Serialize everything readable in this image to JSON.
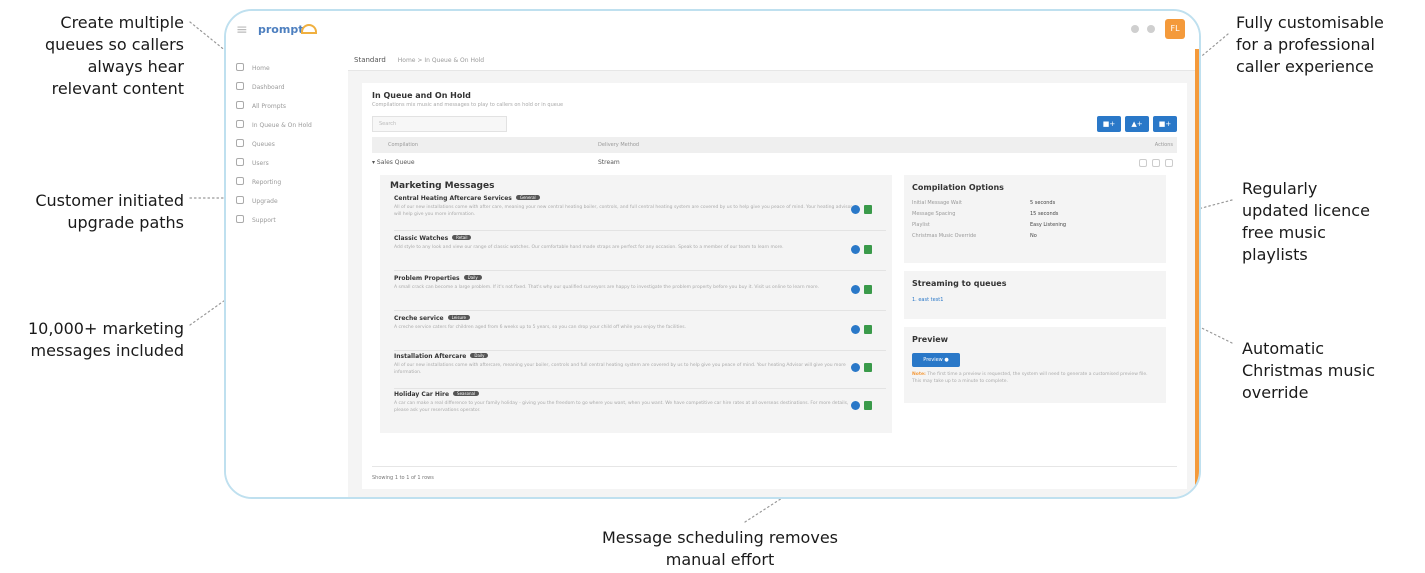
{
  "callouts": {
    "queues": [
      "Create multiple",
      "queues so callers",
      "always hear",
      "relevant content"
    ],
    "upgrade": [
      "Customer initiated",
      "upgrade paths"
    ],
    "marketing": [
      "10,000+ marketing",
      "messages included"
    ],
    "customisable": [
      "Fully customisable",
      "for a professional",
      "caller experience"
    ],
    "playlists": [
      "Regularly",
      "updated licence",
      "free music",
      "playlists"
    ],
    "christmas": [
      "Automatic",
      "Christmas music",
      "override"
    ],
    "scheduling": [
      "Message scheduling removes",
      "manual effort"
    ]
  },
  "app": {
    "logo": "prompt",
    "avatar": "FL"
  },
  "sidebar": {
    "items": [
      "Home",
      "Dashboard",
      "All Prompts",
      "In Queue & On Hold",
      "Queues",
      "Users",
      "Reporting",
      "Upgrade",
      "Support"
    ]
  },
  "breadcrumb": {
    "section": "Standard",
    "path": "Home > In Queue & On Hold"
  },
  "page": {
    "title": "In Queue and On Hold",
    "subtitle": "Compilations mix music and messages to play to callers on hold or in queue",
    "search_placeholder": "Search",
    "add_buttons": [
      "■+",
      "▲+",
      "■+"
    ]
  },
  "table": {
    "columns": [
      "Compilation",
      "Delivery Method",
      "Actions"
    ],
    "row": {
      "compilation": "▾ Sales Queue",
      "delivery": "Stream"
    }
  },
  "marketing": {
    "title": "Marketing Messages",
    "messages": [
      {
        "title": "Central Heating Aftercare Services",
        "tag": "General",
        "desc": "All of our new installations come with after care, meaning your new central heating boiler, controls, and full central heating system are covered by us to help give you peace of mind. Your heating advisor will help give you more information."
      },
      {
        "title": "Classic Watches",
        "tag": "Retail",
        "desc": "Add style to any look and view our range of classic watches. Our comfortable hand made straps are perfect for any occasion. Speak to a member of our team to learn more."
      },
      {
        "title": "Problem Properties",
        "tag": "Daily",
        "desc": "A small crack can become a large problem. If it's not fixed. That's why our qualified surveyors are happy to investigate the problem property before you buy it. Visit us online to learn more."
      },
      {
        "title": "Creche service",
        "tag": "Leisure",
        "desc": "A creche service caters for children aged from 6 weeks up to 5 years, so you can drop your child off while you enjoy the facilities."
      },
      {
        "title": "Installation Aftercare",
        "tag": "Daily",
        "desc": "All of our new installations come with aftercare, meaning your boiler, controls and full central heating system are covered by us to help give you peace of mind. Your heating Advisor will give you more information."
      },
      {
        "title": "Holiday Car Hire",
        "tag": "Seasonal",
        "desc": "A car can make a real difference to your family holiday - giving you the freedom to go where you want, when you want. We have competitive car hire rates at all overseas destinations. For more details, please ask your reservations operator."
      }
    ]
  },
  "options": {
    "title": "Compilation Options",
    "rows": [
      {
        "label": "Initial Message Wait",
        "value": "5 seconds"
      },
      {
        "label": "Message Spacing",
        "value": "15 seconds"
      },
      {
        "label": "Playlist",
        "value": "Easy Listening"
      },
      {
        "label": "Christmas Music Override",
        "value": "No"
      }
    ]
  },
  "streaming": {
    "title": "Streaming to queues",
    "item": "1.   east test1"
  },
  "preview": {
    "title": "Preview",
    "button": "Preview ●",
    "note_label": "Note:",
    "note": "The first time a preview is requested, the system will need to generate a customised preview file. This may take up to a minute to complete."
  },
  "footer": {
    "text": "Showing 1 to 1 of 1 rows"
  }
}
